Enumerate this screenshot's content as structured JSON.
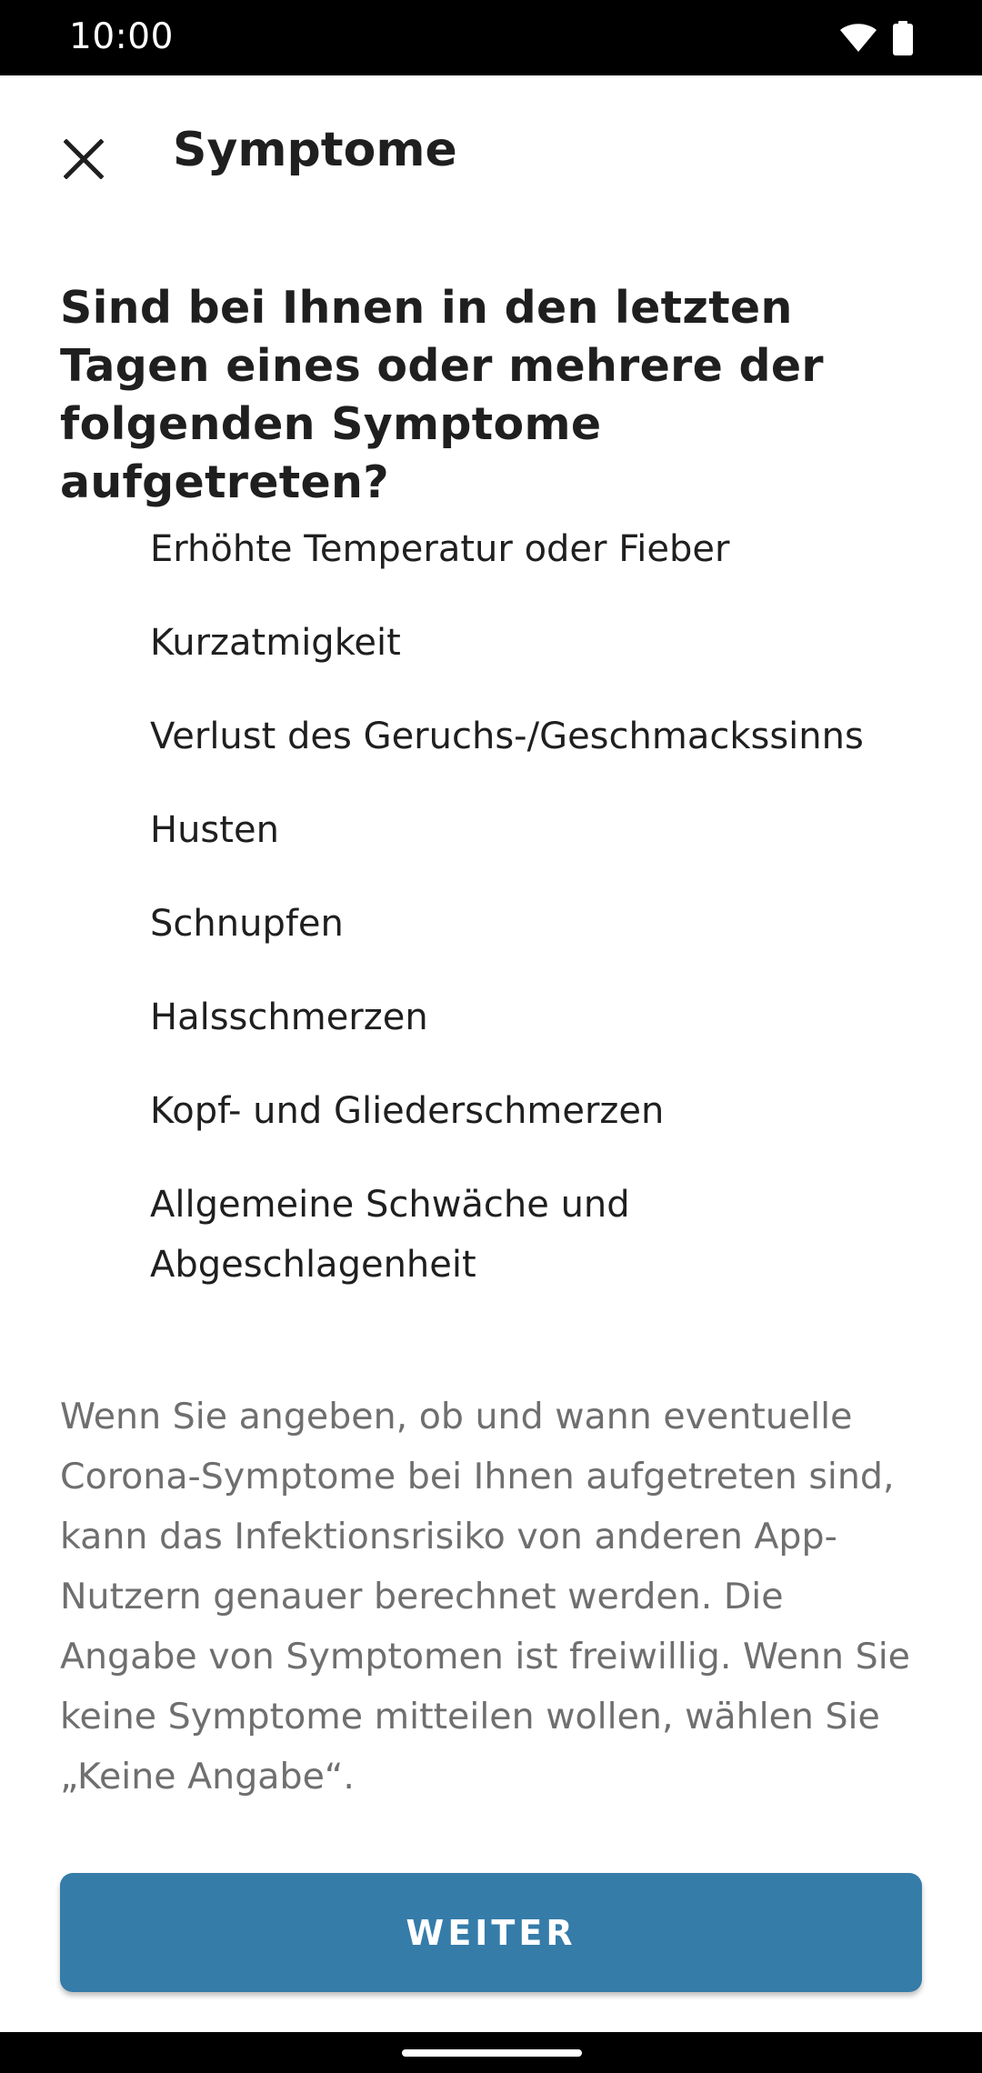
{
  "status_bar": {
    "time": "10:00",
    "icons": [
      "wifi-icon",
      "battery-icon"
    ]
  },
  "app_bar": {
    "close_icon": "close-icon",
    "title": "Symptome"
  },
  "question": "Sind bei Ihnen in den letzten Tagen eines oder mehrere der folgenden Symptome aufgetreten?",
  "symptoms": [
    "Erhöhte Temperatur oder Fieber",
    "Kurzatmigkeit",
    "Verlust des Geruchs-/Geschmackssinns",
    "Husten",
    "Schnupfen",
    "Halsschmerzen",
    "Kopf- und Gliederschmerzen",
    "Allgemeine Schwäche und Abgeschlagenheit"
  ],
  "info_text": "Wenn Sie angeben, ob und wann eventuelle Corona-Symptome bei Ihnen aufgetreten sind, kann das Infektionsrisiko von anderen App-Nutzern genauer berechnet werden. Die Angabe von Symptomen ist freiwillig. Wenn Sie keine Symptome mitteilen wollen, wählen Sie „Keine Angabe“.",
  "button": {
    "label": "WEITER"
  },
  "colors": {
    "button_background": "#357ca9",
    "status_bar": "#000000",
    "info_text": "#6f6f6f"
  }
}
